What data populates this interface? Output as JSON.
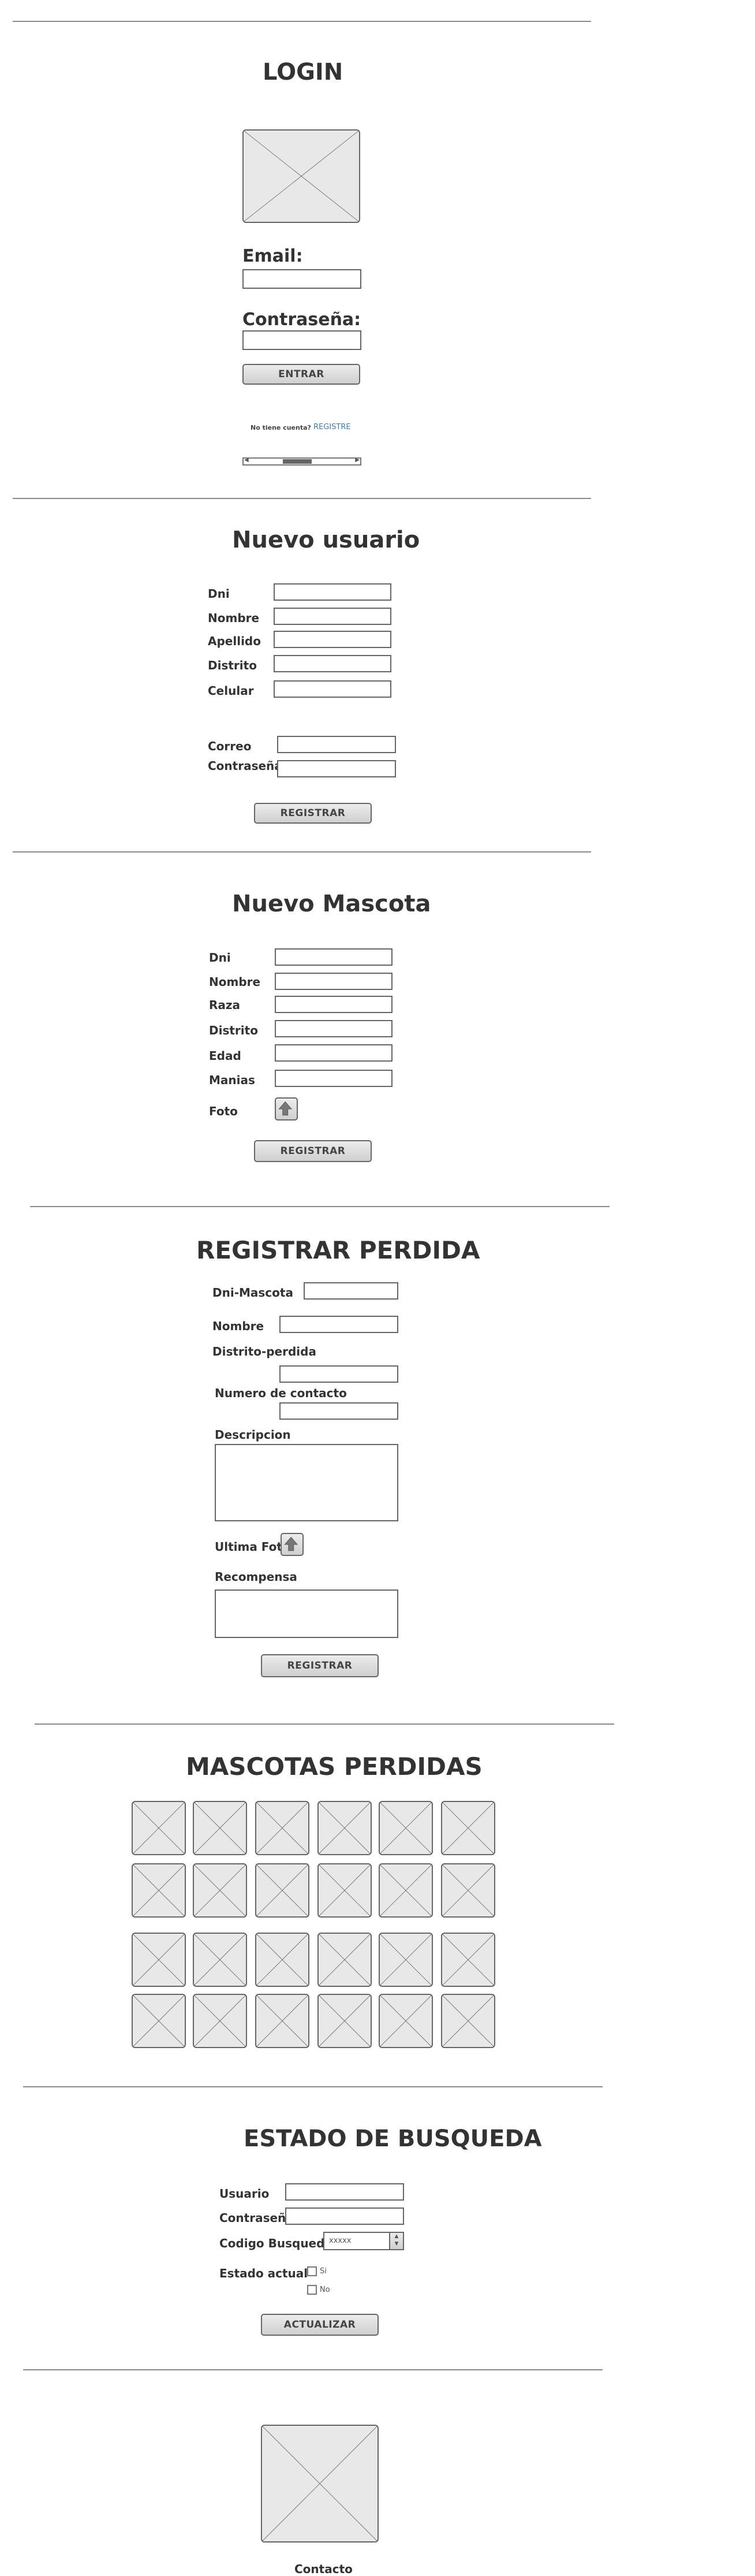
{
  "login": {
    "title": "LOGIN",
    "email_label": "Email:",
    "password_label": "Contraseña:",
    "submit_label": "ENTRAR",
    "no_account_text": "No tiene cuenta?",
    "register_link": "REGISTRE"
  },
  "new_user": {
    "title": "Nuevo usuario",
    "fields": [
      "Dni",
      "Nombre",
      "Apellido",
      "Distrito",
      "Celular"
    ],
    "account_fields": [
      "Correo",
      "Contraseña"
    ],
    "submit_label": "REGISTRAR"
  },
  "new_pet": {
    "title": "Nuevo Mascota",
    "fields": [
      "Dni",
      "Nombre",
      "Raza",
      "Distrito",
      "Edad",
      "Manias"
    ],
    "photo_label": "Foto",
    "submit_label": "REGISTRAR"
  },
  "lost_report": {
    "title": "REGISTRAR PERDIDA",
    "dni_label": "Dni-Mascota",
    "name_label": "Nombre",
    "district_label": "Distrito-perdida",
    "contact_label": "Numero de contacto",
    "description_label": "Descripcion",
    "photo_label": "Ultima Foto",
    "reward_label": "Recompensa",
    "submit_label": "REGISTRAR"
  },
  "lost_pets": {
    "title": "MASCOTAS PERDIDAS",
    "rows": 4,
    "columns": 6
  },
  "search_status": {
    "title": "ESTADO DE BUSQUEDA",
    "user_label": "Usuario",
    "password_label": "Contraseña",
    "code_label": "Codigo Busqueda",
    "code_value": "xxxxx",
    "status_label": "Estado actual",
    "options": [
      "Si",
      "No"
    ],
    "submit_label": "ACTUALIZAR"
  },
  "footer": {
    "contact_label": "Contacto"
  },
  "colors": {
    "link": "#3a7ec2",
    "placeholder_fill": "#e8e8e8",
    "border": "#666666"
  }
}
